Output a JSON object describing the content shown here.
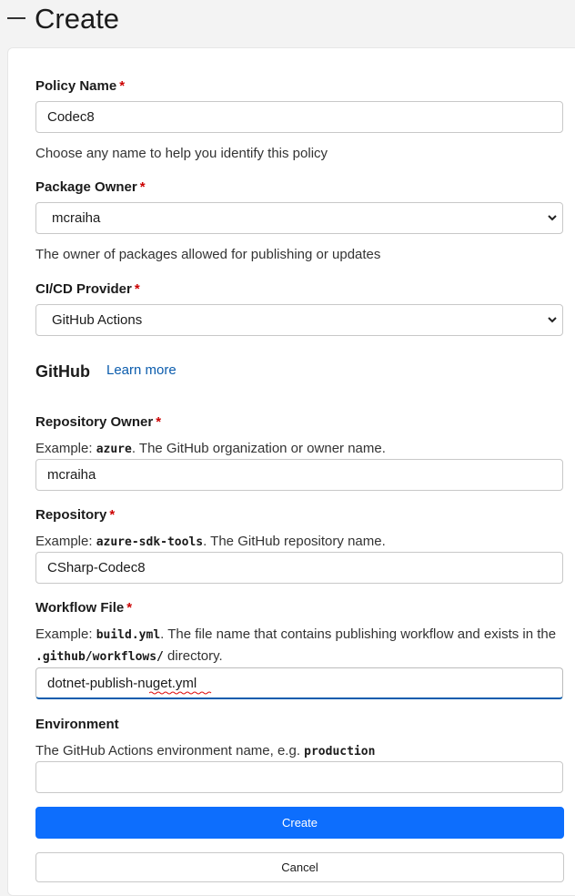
{
  "header": {
    "title": "Create"
  },
  "form": {
    "required_mark": "*",
    "policy_name": {
      "label": "Policy Name",
      "value": "Codec8",
      "help": "Choose any name to help you identify this policy"
    },
    "package_owner": {
      "label": "Package Owner",
      "value": "mcraiha",
      "help": "The owner of packages allowed for publishing or updates"
    },
    "cicd_provider": {
      "label": "CI/CD Provider",
      "value": "GitHub Actions"
    },
    "github_section": {
      "title": "GitHub",
      "learn_more": "Learn more"
    },
    "repository_owner": {
      "label": "Repository Owner",
      "help_prefix": "Example: ",
      "help_code": "azure",
      "help_suffix": ". The GitHub organization or owner name.",
      "value": "mcraiha"
    },
    "repository": {
      "label": "Repository",
      "help_prefix": "Example: ",
      "help_code": "azure-sdk-tools",
      "help_suffix": ". The GitHub repository name.",
      "value": "CSharp-Codec8"
    },
    "workflow_file": {
      "label": "Workflow File",
      "help_prefix": "Example: ",
      "help_code": "build.yml",
      "help_middle": ". The file name that contains publishing workflow and exists in the ",
      "help_code2": ".github/workflows/",
      "help_suffix": " directory.",
      "value": "dotnet-publish-nuget.yml"
    },
    "environment": {
      "label": "Environment",
      "help_prefix": "The GitHub Actions environment name, e.g. ",
      "help_code": "production",
      "value": ""
    }
  },
  "actions": {
    "create_label": "Create",
    "cancel_label": "Cancel"
  },
  "colors": {
    "primary": "#0d6efd",
    "link": "#0b5cad",
    "required": "#cc0000"
  }
}
